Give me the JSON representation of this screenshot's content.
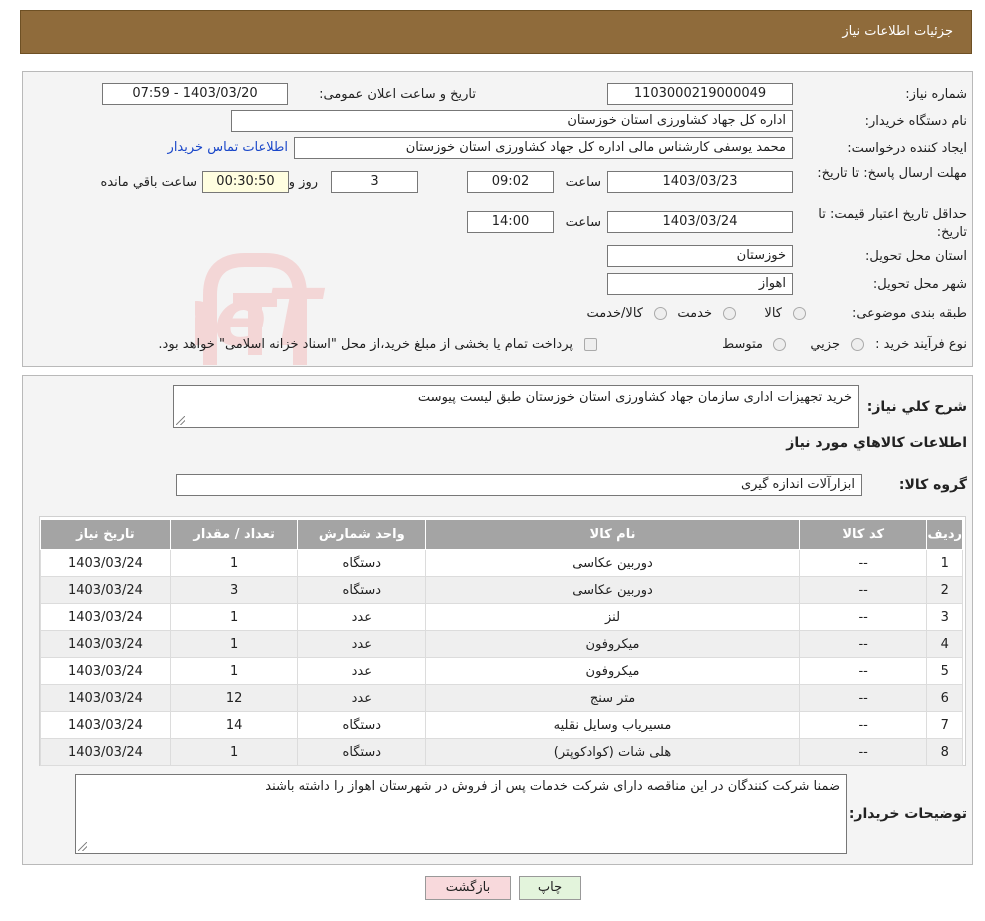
{
  "header": {
    "title": "جزئیات اطلاعات نیاز"
  },
  "fields": {
    "need_number_label": "شماره نیاز:",
    "need_number": "1103000219000049",
    "announce_label": "تاریخ و ساعت اعلان عمومی:",
    "announce_value": "1403/03/20 - 07:59",
    "buyer_org_label": "نام دستگاه خریدار:",
    "buyer_org": "اداره کل جهاد کشاورزی استان خوزستان",
    "creator_label": "ایجاد کننده درخواست:",
    "creator": "محمد یوسفی کارشناس مالی اداره کل جهاد کشاورزی استان خوزستان",
    "contact_link": "اطلاعات تماس خریدار",
    "deadline_label": "مهلت ارسال پاسخ: تا تاریخ:",
    "deadline_date": "1403/03/23",
    "time_label": "ساعت",
    "deadline_time": "09:02",
    "days": "3",
    "days_label": "روز و",
    "remaining": "00:30:50",
    "remaining_label": "ساعت باقي مانده",
    "validity_label": "حداقل تاریخ اعتبار قیمت: تا تاریخ:",
    "validity_date": "1403/03/24",
    "validity_time": "14:00",
    "province_label": "استان محل تحویل:",
    "province": "خوزستان",
    "city_label": "شهر محل تحویل:",
    "city": "اهواز",
    "category_label": "طبقه بندی موضوعی:",
    "category_options": [
      "کالا",
      "خدمت",
      "کالا/خدمت"
    ],
    "process_label": "نوع فرآیند خرید :",
    "process_options": [
      "جزیي",
      "متوسط"
    ],
    "process_note": "پرداخت تمام یا بخشی از مبلغ خرید،از محل \"اسناد خزانه اسلامی\" خواهد بود."
  },
  "summary": {
    "label": "شرح کلي نیاز:",
    "text": "خرید تجهیزات اداری سازمان جهاد کشاورزی استان خوزستان طبق لیست پیوست",
    "goods_info_title": "اطلاعات کالاهاي مورد نياز",
    "group_label": "گروه کالا:",
    "group_value": "ابزارآلات اندازه گیری"
  },
  "table": {
    "headers": [
      "ردیف",
      "کد کالا",
      "نام کالا",
      "واحد شمارش",
      "تعداد / مقدار",
      "تاریخ نیاز"
    ],
    "rows": [
      [
        "1",
        "--",
        "دوربین عکاسی",
        "دستگاه",
        "1",
        "1403/03/24"
      ],
      [
        "2",
        "--",
        "دوربین عکاسی",
        "دستگاه",
        "3",
        "1403/03/24"
      ],
      [
        "3",
        "--",
        "لنز",
        "عدد",
        "1",
        "1403/03/24"
      ],
      [
        "4",
        "--",
        "میکروفون",
        "عدد",
        "1",
        "1403/03/24"
      ],
      [
        "5",
        "--",
        "میکروفون",
        "عدد",
        "1",
        "1403/03/24"
      ],
      [
        "6",
        "--",
        "متر سنج",
        "عدد",
        "12",
        "1403/03/24"
      ],
      [
        "7",
        "--",
        "مسیریاب وسایل نقلیه",
        "دستگاه",
        "14",
        "1403/03/24"
      ],
      [
        "8",
        "--",
        "هلی شات (کوادکوپتر)",
        "دستگاه",
        "1",
        "1403/03/24"
      ]
    ]
  },
  "buyer_notes": {
    "label": "توضیحات خریدار:",
    "text": "ضمنا شرکت کنندگان در این مناقصه دارای شرکت خدمات پس از فروش در شهرستان اهواز را داشته باشند"
  },
  "buttons": {
    "print": "چاپ",
    "back": "بازگشت"
  },
  "watermark": {
    "text": "AriaTender.neT"
  },
  "colors": {
    "header_bg": "#8f6b3b",
    "link": "#1a47c9",
    "back_button_bg": "#f8d9dc",
    "print_button_bg": "#e3f4dc"
  }
}
